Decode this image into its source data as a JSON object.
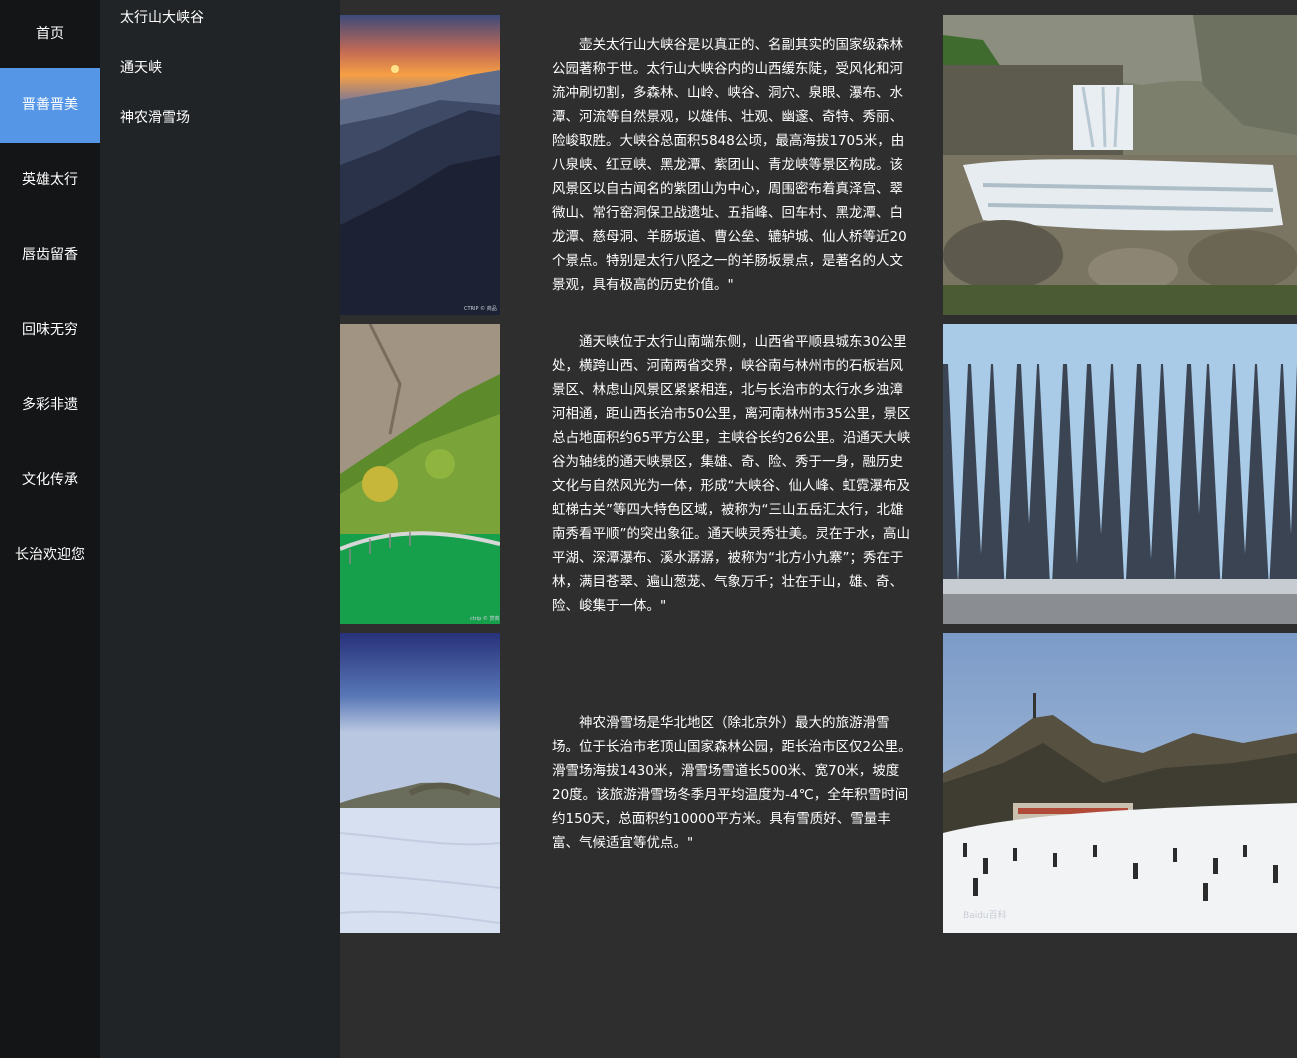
{
  "nav": {
    "items": [
      {
        "label": "首页"
      },
      {
        "label": "晋善晋美"
      },
      {
        "label": "英雄太行"
      },
      {
        "label": "唇齿留香"
      },
      {
        "label": "回味无穷"
      },
      {
        "label": "多彩非遗"
      },
      {
        "label": "文化传承"
      },
      {
        "label": "长治欢迎您"
      }
    ],
    "active_index": 1,
    "active_color": "#5596e6"
  },
  "submenu": {
    "items": [
      {
        "label": "太行山大峡谷"
      },
      {
        "label": "通天峡"
      },
      {
        "label": "神农滑雪场"
      }
    ]
  },
  "sections": [
    {
      "text": "壶关太行山大峡谷是以真正的、名副其实的国家级森林公园著称于世。太行山大峡谷内的山西缓东陡，受风化和河流冲刷切割，多森林、山岭、峡谷、洞穴、泉眼、瀑布、水潭、河流等自然景观，以雄伟、壮观、幽邃、奇特、秀丽、险峻取胜。大峡谷总面积5848公顷，最高海拔1705米，由八泉峡、红豆峡、黑龙潭、紫团山、青龙峡等景区构成。该风景区以自古闻名的紫团山为中心，周围密布着真泽宫、翠微山、常行窑洞保卫战遗址、五指峰、回车村、黑龙潭、白龙潭、慈母洞、羊肠坂道、曹公垒、辘轳城、仙人桥等近20个景点。特别是太行八陉之一的羊肠坂景点，是著名的人文景观，具有极高的历史价值。\"",
      "left_image": {
        "icon": "sunset-mountains-image",
        "watermark": "CTRIP © 商品"
      },
      "right_image": {
        "icon": "waterfall-image"
      }
    },
    {
      "text": "通天峡位于太行山南端东侧，山西省平顺县城东30公里处，横跨山西、河南两省交界，峡谷南与林州市的石板岩风景区、林虑山风景区紧紧相连，北与长治市的太行水乡浊漳河相通，距山西长治市50公里，离河南林州市35公里，景区总占地面积约65平方公里，主峡谷长约26公里。沿通天大峡谷为轴线的通天峡景区，集雄、奇、险、秀于一身，融历史文化与自然风光为一体，形成“大峡谷、仙人峰、虹霓瀑布及虹梯古关”等四大特色区域，被称为“三山五岳汇太行，北雄南秀看平顺”的突出象征。通天峡灵秀壮美。灵在于水，高山平湖、深潭瀑布、溪水潺潺，被称为“北方小九寨”；秀在于林，满目苍翠、遍山葱茏、气象万千；壮在于山，雄、奇、险、峻集于一体。\"",
      "left_image": {
        "icon": "cliff-lake-bridge-image",
        "watermark": "ctrip © 赏商"
      },
      "right_image": {
        "icon": "frozen-icefall-image"
      }
    },
    {
      "text": "神农滑雪场是华北地区（除北京外）最大的旅游滑雪场。位于长治市老顶山国家森林公园，距长治市区仅2公里。滑雪场海拔1430米，滑雪场雪道长500米、宽70米，坡度20度。该旅游滑雪场冬季月平均温度为-4℃，全年积雪时间约150天，总面积约10000平方米。具有雪质好、雪量丰富、气候适宜等优点。\"",
      "left_image": {
        "icon": "snowfield-sky-image"
      },
      "right_image": {
        "icon": "ski-resort-crowd-image",
        "watermark": "Baidu百科"
      }
    }
  ]
}
